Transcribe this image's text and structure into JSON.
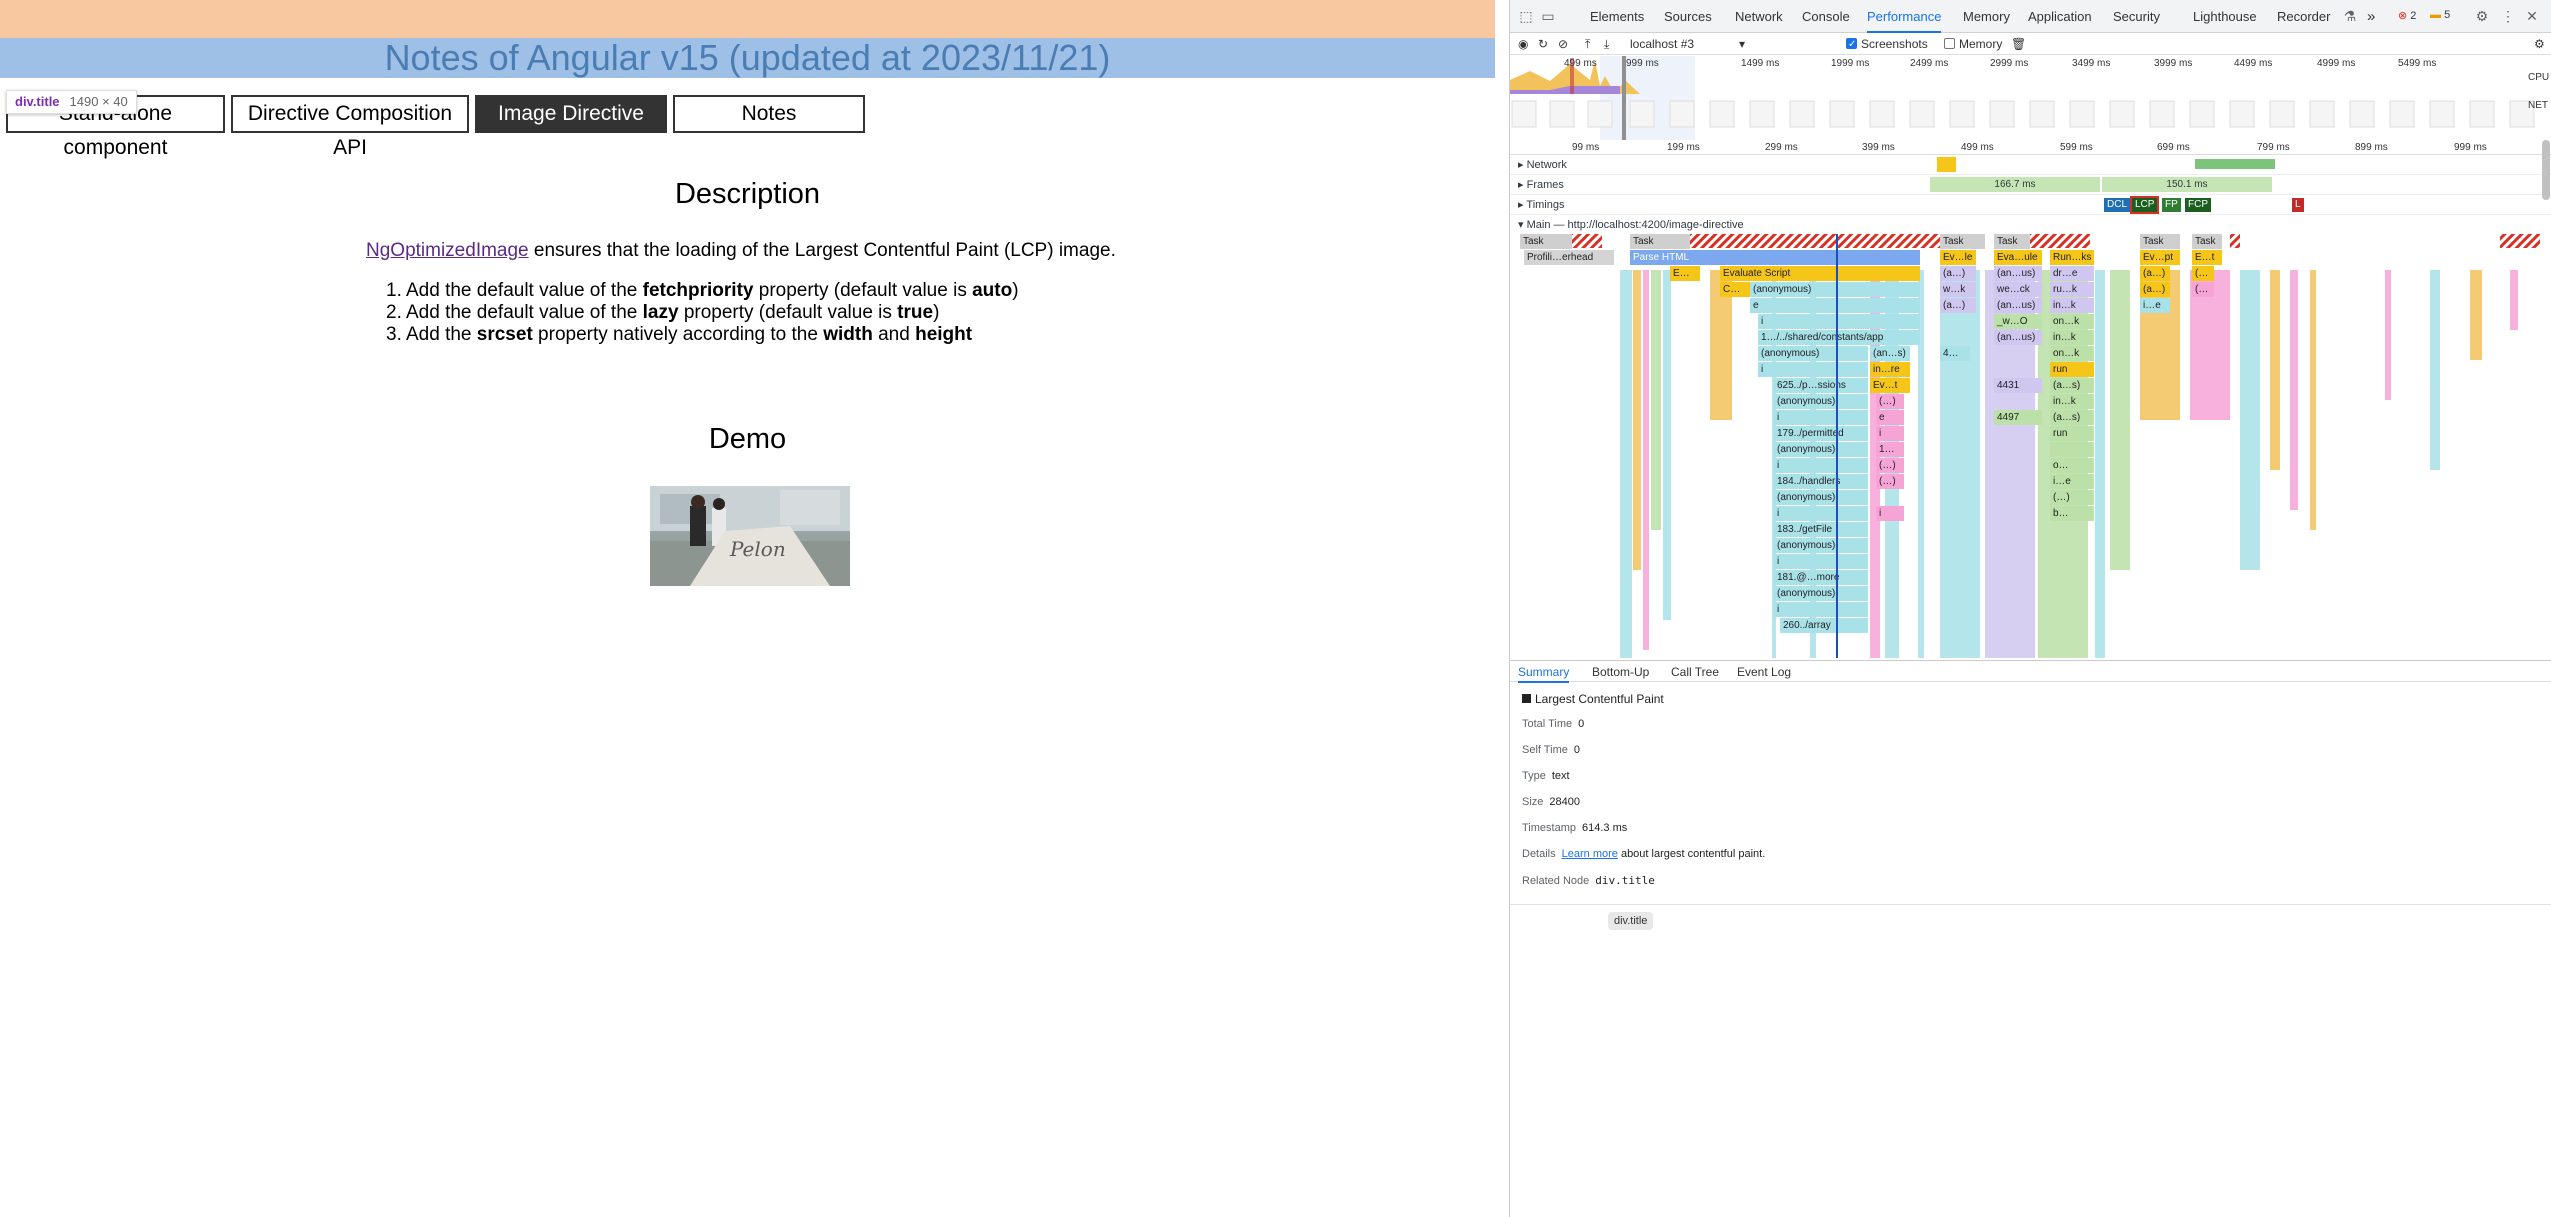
{
  "page": {
    "title": "Notes of Angular v15 (updated at 2023/11/21)",
    "inspect_tooltip": {
      "selector": "div.title",
      "size": "1490 × 40"
    },
    "tabs": [
      {
        "label": "Stand-alone component"
      },
      {
        "label": "Directive Composition API"
      },
      {
        "label": "Image Directive",
        "active": true
      },
      {
        "label": "Notes"
      }
    ],
    "description": {
      "heading": "Description",
      "link_text": "NgOptimizedImage",
      "sentence_rest": " ensures that the loading of the Largest Contentful Paint (LCP) image.",
      "items": [
        {
          "n": "1.",
          "pre": "Add the default value of the ",
          "b1": "fetchpriority",
          "mid": " property (default value is ",
          "b2": "auto",
          "post": ")"
        },
        {
          "n": "2.",
          "pre": "Add the default value of the ",
          "b1": "lazy",
          "mid": " property (default value is ",
          "b2": "true",
          "post": ")"
        },
        {
          "n": "3.",
          "pre": "Add the ",
          "b1": "srcset",
          "mid": " property natively according to the ",
          "b2": "width",
          "and": " and ",
          "b3": "height"
        }
      ]
    },
    "demo": {
      "heading": "Demo"
    }
  },
  "devtools": {
    "tabs": [
      "Elements",
      "Sources",
      "Network",
      "Console",
      "Performance",
      "Memory",
      "Application",
      "Security",
      "Lighthouse",
      "Recorder"
    ],
    "active_tab": "Performance",
    "more": "»",
    "errors": "2",
    "warnings": "5",
    "toolbar": {
      "target": "localhost #3",
      "screenshots_label": "Screenshots",
      "screenshots_checked": true,
      "memory_label": "Memory",
      "memory_checked": false
    },
    "overview_ticks": [
      "499 ms",
      "999 ms",
      "1499 ms",
      "1999 ms",
      "2499 ms",
      "2999 ms",
      "3499 ms",
      "3999 ms",
      "4499 ms",
      "4999 ms",
      "5499 ms"
    ],
    "overview_labels": {
      "cpu": "CPU",
      "net": "NET"
    },
    "ruler_ticks": [
      "99 ms",
      "199 ms",
      "299 ms",
      "399 ms",
      "499 ms",
      "599 ms",
      "699 ms",
      "799 ms",
      "899 ms",
      "999 ms"
    ],
    "tracks": {
      "network": "Network",
      "frames": "Frames",
      "frame_a": "166.7 ms",
      "frame_b": "150.1 ms",
      "timings": "Timings",
      "main": "Main — http://localhost:4200/image-directive"
    },
    "timing_markers": [
      "DCL",
      "LCP",
      "FP",
      "FCP",
      "L"
    ],
    "flame_labels": {
      "task": "Task",
      "profiling": "Profili…erhead",
      "parse_html": "Parse HTML",
      "evaluate_script": "Evaluate Script",
      "e_short": "E…",
      "c_short": "C…",
      "anonymous": "(anonymous)",
      "e": "e",
      "i": "i",
      "app_path": "1…/../shared/constants/app",
      "f625": "625../p…ssions",
      "f179": "179../permitted",
      "f184": "184../handlers",
      "f183": "183../getFile",
      "f181": "181.@…more",
      "f260": "260../array",
      "an_s": "(an…s)",
      "in_re": "in…re",
      "ev_t": "Ev…t",
      "ev_le": "Ev…le",
      "eva_ule": "Eva…ule",
      "run_ks": "Run…ks",
      "a": "(a…)",
      "an_us": "(an…us)",
      "w_k": "w…k",
      "we_ck": "we…ck",
      "dr_e": "dr…e",
      "ru_k": "ru…k",
      "in_k": "in…k",
      "v4431": "4431",
      "v4497": "4497",
      "run": "run",
      "a_s": "(a…s)",
      "on_k": "on…k",
      "ev_pt": "Ev…pt",
      "e_t": "E…t",
      "i_e": "i…e",
      "o": "o…",
      "b": "b…",
      "ellipsis": "(…)",
      "num1": "1…",
      "num4": "4…",
      "w_o": "_w…O",
      "e_pt": "(…"
    },
    "bottom_tabs": [
      "Summary",
      "Bottom-Up",
      "Call Tree",
      "Event Log"
    ],
    "summary": {
      "title": "Largest Contentful Paint",
      "total_time_label": "Total Time",
      "total_time": "0",
      "self_time_label": "Self Time",
      "self_time": "0",
      "type_label": "Type",
      "type": "text",
      "size_label": "Size",
      "size": "28400",
      "timestamp_label": "Timestamp",
      "timestamp": "614.3 ms",
      "details_label": "Details",
      "details_link": "Learn more",
      "details_rest": " about largest contentful paint.",
      "related_node_label": "Related Node",
      "related_node": "div.title",
      "hover_pill": "div.title"
    }
  }
}
